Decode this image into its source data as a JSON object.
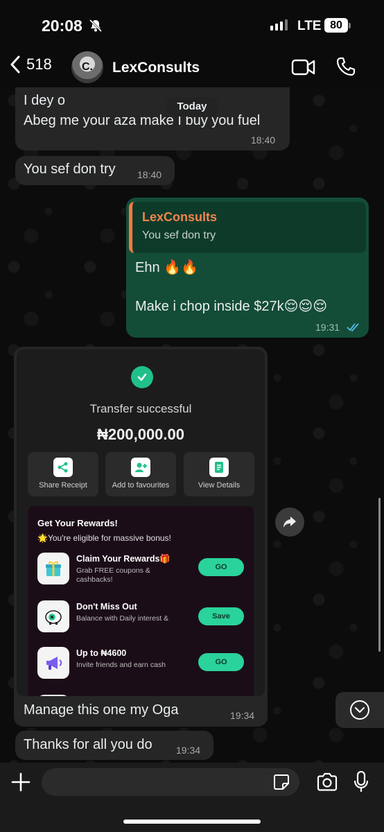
{
  "status_bar": {
    "time": "20:08",
    "network": "LTE",
    "battery": "80"
  },
  "header": {
    "back_count": "518",
    "contact_name": "LexConsults",
    "avatar_initials": "C."
  },
  "date_divider": "Today",
  "messages": [
    {
      "direction": "incoming",
      "lines": [
        "I dey o",
        "Abeg me your aza make I buy you fuel"
      ],
      "time": "18:40"
    },
    {
      "direction": "incoming",
      "text": "You sef don try",
      "time": "18:40"
    },
    {
      "direction": "outgoing",
      "reply_to": {
        "author": "LexConsults",
        "text": "You sef don try"
      },
      "line1": "Ehn 🔥🔥",
      "line2": "Make i chop inside $27k😌😌😌",
      "time": "19:31",
      "status": "read"
    },
    {
      "direction": "incoming",
      "caption": "Manage this one my Oga",
      "time": "19:34"
    },
    {
      "direction": "incoming",
      "text": "Thanks for all you do",
      "time": "19:34"
    }
  ],
  "receipt": {
    "title": "Transfer successful",
    "amount": "₦200,000.00",
    "actions": [
      "Share Receipt",
      "Add to favourites",
      "View Details"
    ],
    "rewards_title": "Get Your Rewards!",
    "rewards_subtitle": "🌟You're eligible for massive bonus!",
    "reward_items": [
      {
        "name": "Claim Your Rewards🎁",
        "desc": "Grab FREE coupons & cashbacks!",
        "button": "GO"
      },
      {
        "name": "Don't Miss Out",
        "desc": "Balance with Daily interest &",
        "button": "Save"
      },
      {
        "name": "Up to ₦4600",
        "desc": "Invite friends and earn cash",
        "button": "GO"
      }
    ]
  },
  "input": {
    "placeholder": ""
  },
  "colors": {
    "outgoing_bubble": "#144d37",
    "incoming_bubble": "#262626",
    "accent_green": "#2ad39b",
    "reply_author": "#f5844d",
    "read_ticks": "#53bdeb"
  }
}
